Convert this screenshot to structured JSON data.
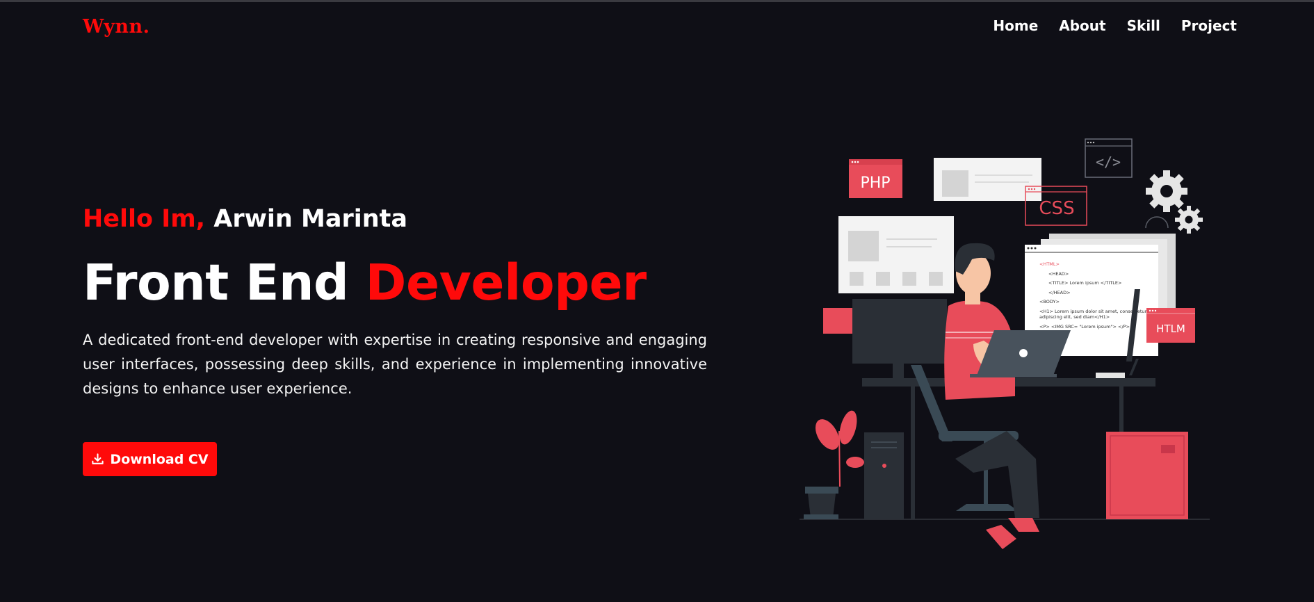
{
  "brand": {
    "logo": "Wynn."
  },
  "nav": {
    "items": [
      "Home",
      "About",
      "Skill",
      "Project"
    ]
  },
  "hero": {
    "greeting_red": "Hello Im,",
    "greeting_name": "Arwin Marinta",
    "title_white": "Front End",
    "title_red": "Developer",
    "description": "A dedicated front-end developer with expertise in creating responsive and engaging user interfaces, possessing deep skills, and experience in implementing innovative designs to enhance user experience.",
    "cv_button": "Download CV",
    "cv_icon": "download-icon"
  },
  "illustration": {
    "tags": {
      "php": "PHP",
      "css": "CSS",
      "htlm": "HTLM",
      "code_icon": "</>"
    },
    "code_lines": {
      "l1": "<HTML>",
      "l2": "<HEAD>",
      "l3": "<TITLE> Lorem ipsum </TITLE>",
      "l4": "</HEAD>",
      "l5": "<BODY>",
      "l6": "<H1> Lorem ipsum dolor sit amet, consectetur",
      "l7": "adipiscing elit, sed diam</H1>",
      "l8": "<P> <IMG SRC= \"Lorem ipsum\"> </P>"
    }
  },
  "colors": {
    "background": "#0f0f16",
    "accent": "#ff0a0a",
    "illustration_red": "#e84c5a",
    "text": "#ffffff"
  }
}
